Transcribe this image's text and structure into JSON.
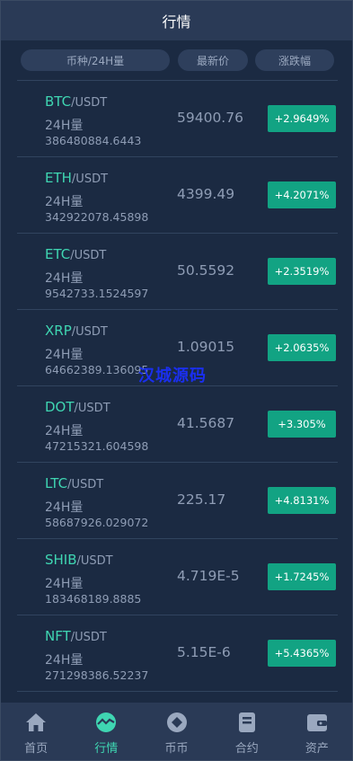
{
  "header": {
    "title": "行情"
  },
  "columns": {
    "pair": "币种/24H量",
    "price": "最新价",
    "change": "涨跌幅"
  },
  "volume_label": "24H量",
  "rows": [
    {
      "base": "BTC",
      "quote": "/USDT",
      "volume": "386480884.6443",
      "price": "59400.76",
      "change": "+2.9649%"
    },
    {
      "base": "ETH",
      "quote": "/USDT",
      "volume": "342922078.45898",
      "price": "4399.49",
      "change": "+4.2071%"
    },
    {
      "base": "ETC",
      "quote": "/USDT",
      "volume": "9542733.1524597",
      "price": "50.5592",
      "change": "+2.3519%"
    },
    {
      "base": "XRP",
      "quote": "/USDT",
      "volume": "64662389.136095",
      "price": "1.09015",
      "change": "+2.0635%"
    },
    {
      "base": "DOT",
      "quote": "/USDT",
      "volume": "47215321.604598",
      "price": "41.5687",
      "change": "+3.305%"
    },
    {
      "base": "LTC",
      "quote": "/USDT",
      "volume": "58687926.029072",
      "price": "225.17",
      "change": "+4.8131%"
    },
    {
      "base": "SHIB",
      "quote": "/USDT",
      "volume": "183468189.8885",
      "price": "4.719E-5",
      "change": "+1.7245%"
    },
    {
      "base": "NFT",
      "quote": "/USDT",
      "volume": "271298386.52237",
      "price": "5.15E-6",
      "change": "+5.4365%"
    }
  ],
  "watermark": "汉城源码",
  "tabs": [
    {
      "label": "首页",
      "icon": "home-icon",
      "active": false
    },
    {
      "label": "行情",
      "icon": "market-icon",
      "active": true
    },
    {
      "label": "币币",
      "icon": "coin-icon",
      "active": false
    },
    {
      "label": "合约",
      "icon": "contract-icon",
      "active": false
    },
    {
      "label": "资产",
      "icon": "wallet-icon",
      "active": false
    }
  ],
  "colors": {
    "accent": "#3fd6b2",
    "up": "#12a383",
    "background": "#1b2a42",
    "bar": "#2a3a56"
  }
}
